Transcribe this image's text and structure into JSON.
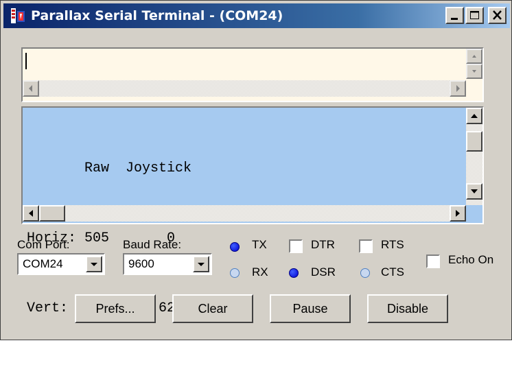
{
  "window": {
    "title": "Parallax Serial Terminal - (COM24)"
  },
  "terminal": {
    "lines": [
      "       Raw  Joystick",
      "Horiz: 505       0",
      "Vert:  525      625"
    ]
  },
  "controls": {
    "com_port_label": "Com Port:",
    "com_port_value": "COM24",
    "baud_rate_label": "Baud Rate:",
    "baud_rate_value": "9600",
    "indicators": {
      "tx": {
        "label": "TX",
        "state": "on"
      },
      "rx": {
        "label": "RX",
        "state": "off"
      },
      "dsr": {
        "label": "DSR",
        "state": "on"
      },
      "cts": {
        "label": "CTS",
        "state": "off"
      }
    },
    "checkboxes": {
      "dtr": {
        "label": "DTR",
        "checked": false
      },
      "rts": {
        "label": "RTS",
        "checked": false
      },
      "echo": {
        "label": "Echo On",
        "checked": false
      }
    }
  },
  "buttons": {
    "prefs": "Prefs...",
    "clear": "Clear",
    "pause": "Pause",
    "disable": "Disable"
  },
  "colors": {
    "title_bar_start": "#0a246a",
    "output_background": "#a6caf0",
    "input_background": "#fff8e8",
    "led_on": "#0000d0"
  }
}
